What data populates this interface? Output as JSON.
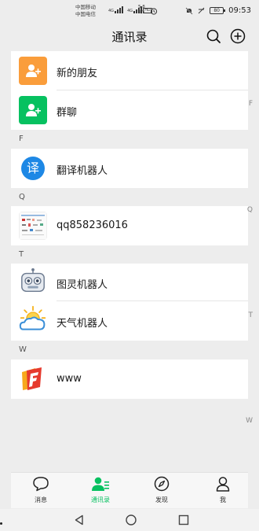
{
  "statusbar": {
    "carrier1": "中国移动",
    "carrier2": "中国电信",
    "tag_hd": "HD",
    "net1": "4G",
    "net2": "4G",
    "speed_value": "5.8",
    "speed_unit": "K/s",
    "battery": "80",
    "time": "09:53"
  },
  "header": {
    "title": "通讯录"
  },
  "contacts": {
    "new_friends": "新的朋友",
    "group_chat": "群聊",
    "section_f": "F",
    "translate_bot": "翻译机器人",
    "translate_icon_char": "译",
    "section_q": "Q",
    "qq": "qq858236016",
    "section_t": "T",
    "turing_bot": "图灵机器人",
    "weather_bot": "天气机器人",
    "section_w": "W",
    "www": "www"
  },
  "index_letters": [
    "F",
    "Q",
    "T",
    "W"
  ],
  "tabs": [
    {
      "label": "消息",
      "icon": "chat-bubble-icon"
    },
    {
      "label": "通讯录",
      "icon": "contacts-icon",
      "active": true
    },
    {
      "label": "发现",
      "icon": "compass-icon"
    },
    {
      "label": "我",
      "icon": "person-icon"
    }
  ],
  "colors": {
    "accent": "#07c160",
    "new_friends_bg": "#fa9d3b",
    "group_bg": "#07c160",
    "translate_bg": "#1e88e5"
  }
}
